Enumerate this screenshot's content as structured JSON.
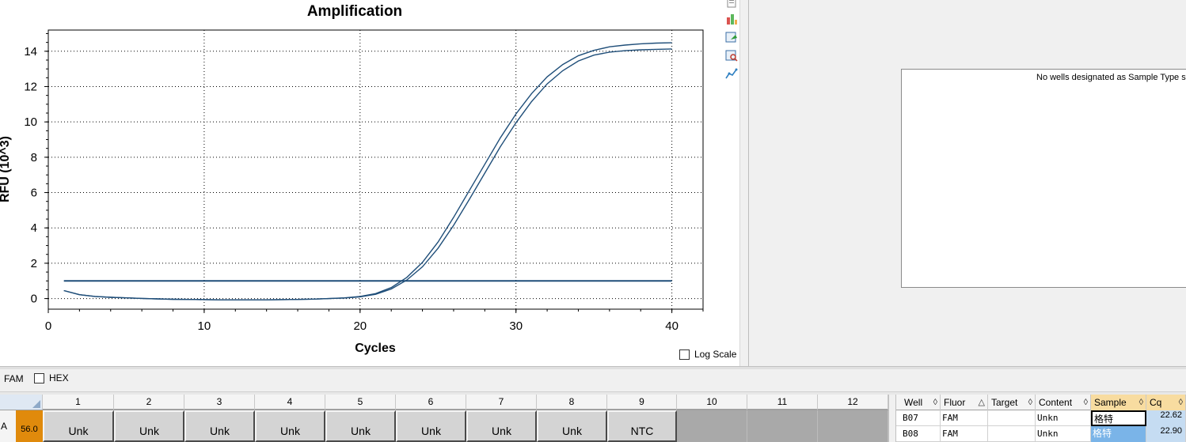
{
  "chart": {
    "title": "Amplification",
    "xlabel": "Cycles",
    "ylabel": "RFU (10^3)",
    "log_scale_label": "Log Scale",
    "log_scale_checked": false
  },
  "chart_data": {
    "type": "line",
    "title": "Amplification",
    "xlabel": "Cycles",
    "ylabel": "RFU (10^3)",
    "xlim": [
      0,
      42
    ],
    "ylim": [
      -0.6,
      15.2
    ],
    "xticks": [
      0,
      10,
      20,
      30,
      40
    ],
    "yticks": [
      0,
      2,
      4,
      6,
      8,
      10,
      12,
      14
    ],
    "grid": true,
    "threshold": 1.0,
    "color": "#1f4e79",
    "series": [
      {
        "x": [
          1,
          2,
          3,
          4,
          5,
          6,
          7,
          8,
          9,
          10,
          11,
          12,
          13,
          14,
          15,
          16,
          17,
          18,
          19,
          20,
          21,
          22,
          23,
          24,
          25,
          26,
          27,
          28,
          29,
          30,
          31,
          32,
          33,
          34,
          35,
          36,
          37,
          38,
          39,
          40
        ],
        "values": [
          0.45,
          0.22,
          0.12,
          0.07,
          0.04,
          0.01,
          -0.02,
          -0.04,
          -0.05,
          -0.06,
          -0.07,
          -0.07,
          -0.07,
          -0.07,
          -0.06,
          -0.05,
          -0.03,
          0.0,
          0.04,
          0.12,
          0.28,
          0.62,
          1.2,
          2.05,
          3.2,
          4.6,
          6.1,
          7.6,
          9.1,
          10.45,
          11.6,
          12.55,
          13.25,
          13.75,
          14.05,
          14.25,
          14.35,
          14.42,
          14.46,
          14.48
        ]
      },
      {
        "x": [
          1,
          2,
          3,
          4,
          5,
          6,
          7,
          8,
          9,
          10,
          11,
          12,
          13,
          14,
          15,
          16,
          17,
          18,
          19,
          20,
          21,
          22,
          23,
          24,
          25,
          26,
          27,
          28,
          29,
          30,
          31,
          32,
          33,
          34,
          35,
          36,
          37,
          38,
          39,
          40
        ],
        "values": [
          0.45,
          0.22,
          0.12,
          0.07,
          0.04,
          0.01,
          -0.02,
          -0.04,
          -0.05,
          -0.06,
          -0.07,
          -0.07,
          -0.07,
          -0.07,
          -0.06,
          -0.05,
          -0.03,
          0.0,
          0.03,
          0.1,
          0.24,
          0.54,
          1.05,
          1.8,
          2.85,
          4.15,
          5.6,
          7.1,
          8.6,
          9.95,
          11.15,
          12.15,
          12.9,
          13.45,
          13.78,
          13.95,
          14.03,
          14.08,
          14.11,
          14.13
        ]
      }
    ]
  },
  "right_panel": {
    "message": "No wells designated as Sample Type sta"
  },
  "fluor_bar": {
    "fam_label": "FAM",
    "hex_label": "HEX",
    "hex_checked": false
  },
  "plate": {
    "columns": [
      "1",
      "2",
      "3",
      "4",
      "5",
      "6",
      "7",
      "8",
      "9",
      "10",
      "11",
      "12"
    ],
    "row_letter": "A",
    "row_temp": "56.0",
    "wells": [
      "Unk",
      "Unk",
      "Unk",
      "Unk",
      "Unk",
      "Unk",
      "Unk",
      "Unk",
      "NTC",
      "",
      "",
      ""
    ]
  },
  "results_table": {
    "headers": [
      "Well",
      "Fluor",
      "Target",
      "Content",
      "Sample",
      "Cq"
    ],
    "sort_marks": [
      "◊",
      "△",
      "◊",
      "◊",
      "◊",
      "◊"
    ],
    "rows": [
      {
        "well": "B07",
        "fluor": "FAM",
        "target": "",
        "content": "Unkn",
        "sample": "格特",
        "cq": "22.62"
      },
      {
        "well": "B08",
        "fluor": "FAM",
        "target": "",
        "content": "Unkn",
        "sample": "格特",
        "cq": "22.90"
      }
    ]
  },
  "icons": [
    "export-icon",
    "chart-color-icon",
    "refresh-chart-icon",
    "zoom-chart-icon",
    "trace-icon"
  ]
}
